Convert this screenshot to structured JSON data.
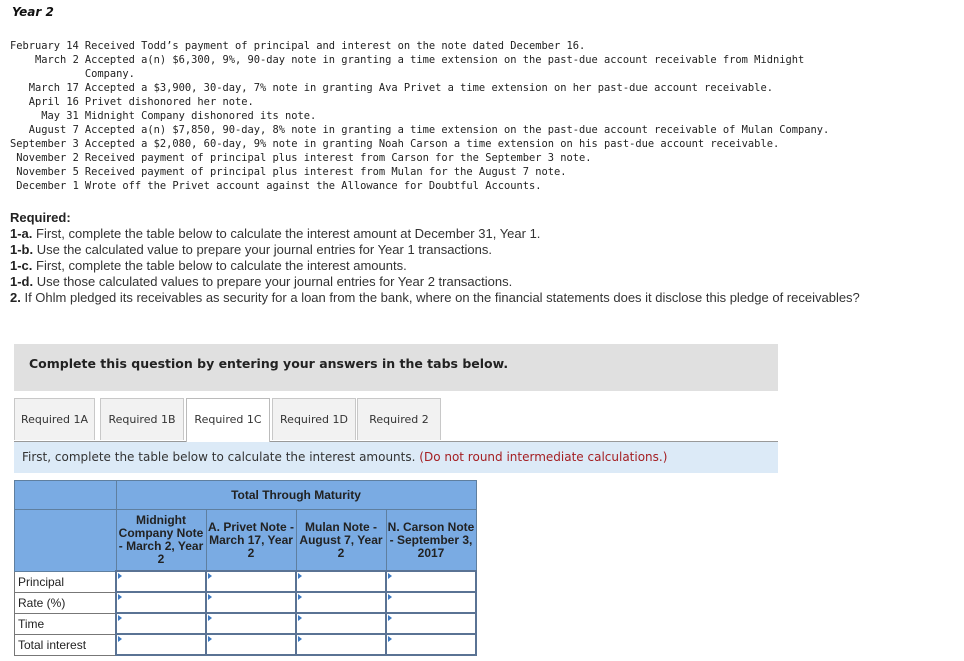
{
  "year_title": "Year 2",
  "transactions": [
    {
      "date": "February 14",
      "text": "Received Todd’s payment of principal and interest on the note dated December 16."
    },
    {
      "date": "March 2",
      "text": "Accepted a(n) $6,300, 9%, 90-day note in granting a time extension on the past-due account receivable from Midnight\nCompany."
    },
    {
      "date": "March 17",
      "text": "Accepted a $3,900, 30-day, 7% note in granting Ava Privet a time extension on her past-due account receivable."
    },
    {
      "date": "April 16",
      "text": "Privet dishonored her note."
    },
    {
      "date": "May 31",
      "text": "Midnight Company dishonored its note."
    },
    {
      "date": "August 7",
      "text": "Accepted a(n) $7,850, 90-day, 8% note in granting a time extension on the past-due account receivable of Mulan Company."
    },
    {
      "date": "September 3",
      "text": "Accepted a $2,080, 60-day, 9% note in granting Noah Carson a time extension on his past-due account receivable."
    },
    {
      "date": "November 2",
      "text": "Received payment of principal plus interest from Carson for the September 3 note."
    },
    {
      "date": "November 5",
      "text": "Received payment of principal plus interest from Mulan for the August 7 note."
    },
    {
      "date": "December 1",
      "text": "Wrote off the Privet account against the Allowance for Doubtful Accounts."
    }
  ],
  "required": {
    "heading": "Required:",
    "items": [
      {
        "label": "1-a.",
        "text": " First, complete the table below to calculate the interest amount at December 31, Year 1."
      },
      {
        "label": "1-b.",
        "text": " Use the calculated value to prepare your journal entries for Year 1 transactions."
      },
      {
        "label": "1-c.",
        "text": " First, complete the table below to calculate the interest amounts."
      },
      {
        "label": "1-d.",
        "text": " Use those calculated values to prepare your journal entries for Year 2 transactions."
      },
      {
        "label": "2.",
        "text": " If Ohlm pledged its receivables as security for a loan from the bank, where on the financial statements does it disclose this pledge of receivables?"
      }
    ]
  },
  "banner": "Complete this question by entering your answers in the tabs below.",
  "tabs": [
    {
      "label": "Required 1A",
      "active": false
    },
    {
      "label": "Required 1B",
      "active": false
    },
    {
      "label": "Required 1C",
      "active": true
    },
    {
      "label": "Required 1D",
      "active": false
    },
    {
      "label": "Required 2",
      "active": false
    }
  ],
  "instruction": {
    "main": "First, complete the table below to calculate the interest amounts.",
    "note": "(Do not round intermediate calculations.)"
  },
  "calc_table": {
    "group_header": "Total Through Maturity",
    "columns": [
      "Midnight Company Note - March 2, Year 2",
      "A. Privet Note - March 17, Year 2",
      "Mulan Note - August 7, Year 2",
      "N. Carson Note - September 3, 2017"
    ],
    "rows": [
      {
        "label": "Principal",
        "values": [
          "",
          "",
          "",
          ""
        ]
      },
      {
        "label": "Rate (%)",
        "values": [
          "",
          "",
          "",
          ""
        ]
      },
      {
        "label": "Time",
        "values": [
          "",
          "",
          "",
          ""
        ]
      },
      {
        "label": "Total interest",
        "values": [
          "",
          "",
          "",
          ""
        ]
      }
    ]
  },
  "colors": {
    "header_blue": "#7aabe3",
    "instruction_bg": "#dceaf7",
    "note_red": "#a41e22",
    "banner_gray": "#e0e0e0"
  }
}
